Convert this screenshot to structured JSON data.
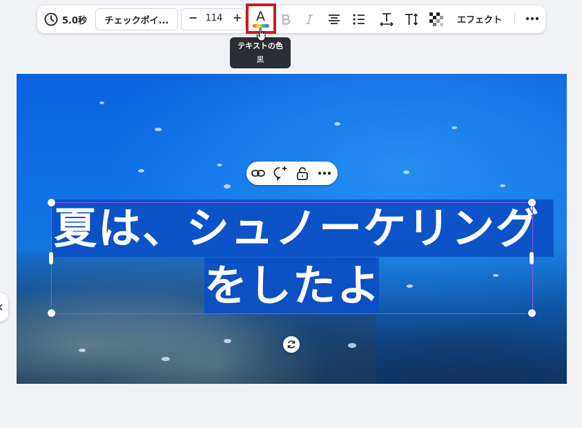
{
  "toolbar": {
    "duration": "5.0秒",
    "font_name": "チェックポイ...",
    "font_size": "114",
    "size_minus": "−",
    "size_plus": "+",
    "effect_label": "エフェクト"
  },
  "tooltip": {
    "title": "テキストの色",
    "value": "黒"
  },
  "canvas": {
    "text_line1": "夏は、シュノーケリング",
    "text_line2": "をしたよ"
  },
  "colors": {
    "accent": "#8f56f2",
    "highlight_box": "#cc1a1f",
    "text_background": "#0c4fc4"
  },
  "icons": [
    "clock-icon",
    "text-color-icon",
    "bold-icon",
    "italic-icon",
    "align-center-icon",
    "list-icon",
    "letter-spacing-icon",
    "text-size-icon",
    "transparency-icon",
    "more-icon",
    "link-icon",
    "comment-add-icon",
    "lock-icon",
    "rotate-icon",
    "chevron-left-icon"
  ]
}
